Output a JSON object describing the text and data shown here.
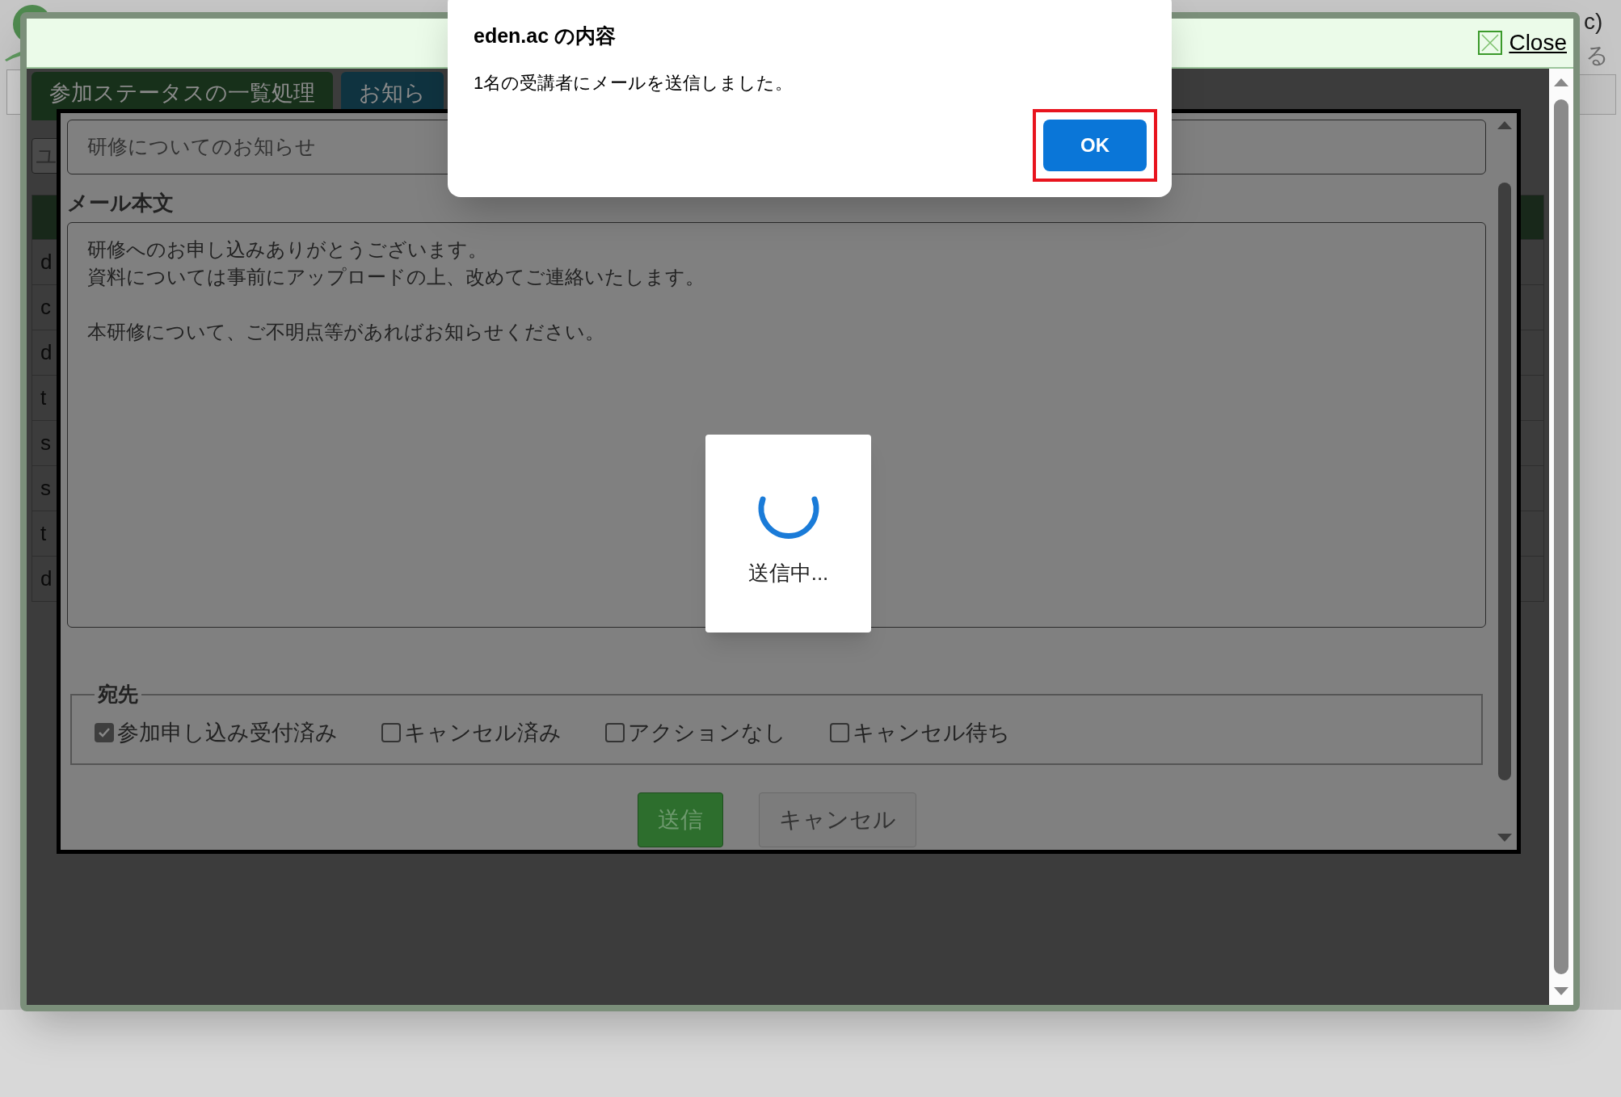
{
  "background": {
    "corner_text": "c)",
    "corner_glyph": "る"
  },
  "frame": {
    "close_label": "Close"
  },
  "tabs": [
    {
      "label": "参加ステータスの一覧処理",
      "selected": true
    },
    {
      "label": "お知ら",
      "selected": false
    }
  ],
  "toolbar_button": "ユ",
  "rows": [
    "d",
    "c",
    "d",
    "t",
    "s",
    "s",
    "t",
    "d"
  ],
  "mail_form": {
    "subject": "研修についてのお知らせ",
    "body_label": "メール本文",
    "body_paragraphs": [
      [
        "研修へのお申し込みありがとうございます。",
        "資料については事前にアップロードの上、改めてご連絡いたします。"
      ],
      [
        "本研修について、ご不明点等があればお知らせください。"
      ]
    ],
    "recipients": {
      "legend": "宛先",
      "options": [
        {
          "label": "参加申し込み受付済み",
          "checked": true
        },
        {
          "label": "キャンセル済み",
          "checked": false
        },
        {
          "label": "アクションなし",
          "checked": false
        },
        {
          "label": "キャンセル待ち",
          "checked": false
        }
      ]
    },
    "buttons": [
      {
        "label": "送信",
        "kind": "primary"
      },
      {
        "label": "キャンセル",
        "kind": "secondary"
      }
    ]
  },
  "loading": {
    "text": "送信中..."
  },
  "alert": {
    "title": "eden.ac の内容",
    "message": "1名の受講者にメールを送信しました。",
    "button": "OK",
    "highlighted": true
  }
}
